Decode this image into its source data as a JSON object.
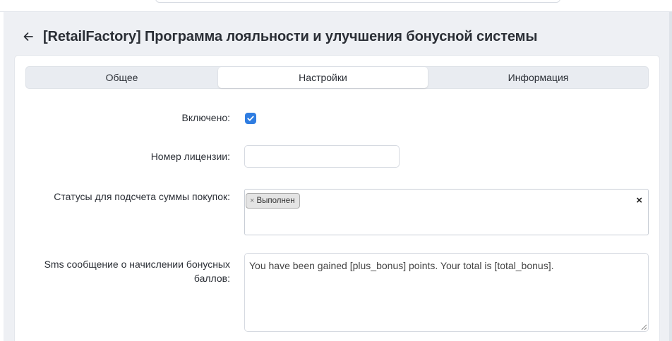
{
  "page": {
    "title": "[RetailFactory] Программа лояльности и улучшения бонусной системы",
    "back_icon": "arrow-left-icon"
  },
  "tabs": [
    {
      "label": "Общее",
      "active": false
    },
    {
      "label": "Настройки",
      "active": true
    },
    {
      "label": "Информация",
      "active": false
    }
  ],
  "form": {
    "enabled": {
      "label": "Включено:",
      "checked": true
    },
    "license": {
      "label": "Номер лицензии:",
      "value": "",
      "placeholder": ""
    },
    "statuses": {
      "label": "Статусы для подсчета суммы покупок:",
      "tags": [
        {
          "remove": "×",
          "text": "Выполнен"
        }
      ],
      "clear": "×"
    },
    "sms": {
      "label": "Sms сообщение о начислении бонусных баллов:",
      "value": "You have been gained [plus_bonus] points. Your total is [total_bonus]."
    }
  },
  "colors": {
    "accent": "#2f7de1",
    "background": "#eef0f4"
  }
}
